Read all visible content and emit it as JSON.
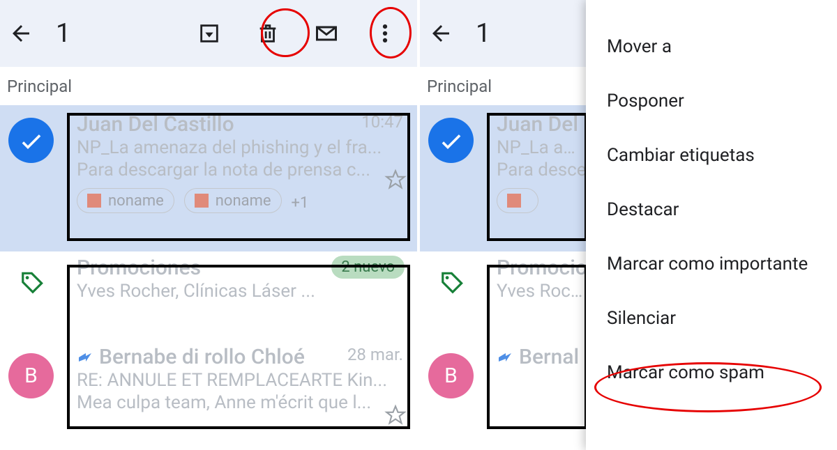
{
  "topbar": {
    "count": "1"
  },
  "tab": {
    "label": "Principal"
  },
  "msg1": {
    "sender": "Juan Del Castillo",
    "time": "10:47",
    "subject": "NP_La amenaza del phishing y el fra...",
    "snippet": "Para descargar la nota de prensa c...",
    "chip1": "noname",
    "chip2": "noname",
    "chipMore": "+1"
  },
  "promo": {
    "title": "Promociones",
    "sub": "Yves Rocher, Clínicas Láser ...",
    "badge": "2 nuevo"
  },
  "msg2": {
    "sender": "Bernabe di rollo Chloé",
    "time": "28 mar.",
    "subject": "RE: ANNULE ET REMPLACEARTE Kin...",
    "snippet": "Mea culpa team, Anne m'écrit que l..."
  },
  "avatarB": "B",
  "right": {
    "msg1snippet": "Para desce",
    "promoSub": "Yves Roch…",
    "msg2sender": "Bernal"
  },
  "menu": {
    "m1": "Mover a",
    "m2": "Posponer",
    "m3": "Cambiar etiquetas",
    "m4": "Destacar",
    "m5": "Marcar como importante",
    "m6": "Silenciar",
    "m7": "Marcar como spam"
  }
}
